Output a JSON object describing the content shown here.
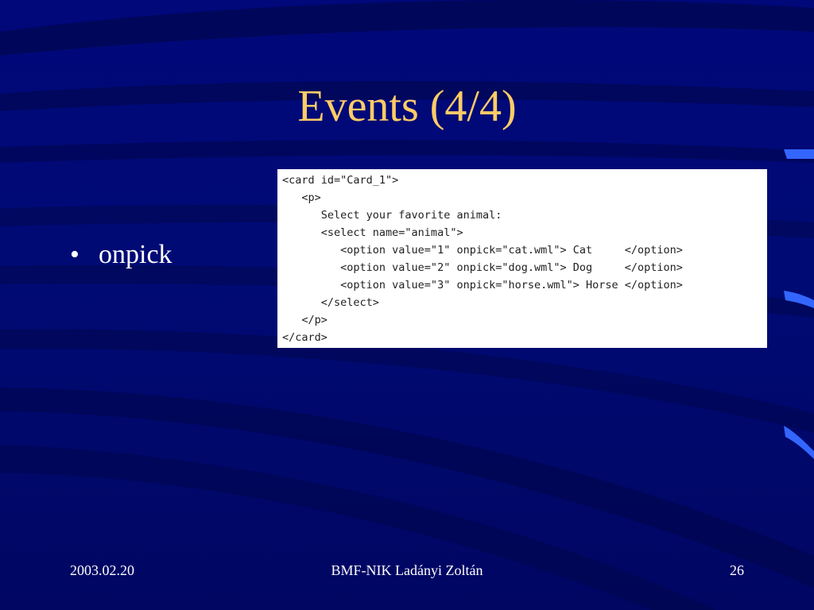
{
  "slide": {
    "title": "Events (4/4)",
    "bullets": [
      {
        "symbol": "•",
        "text": "onpick"
      }
    ],
    "code_lines": [
      "<card id=\"Card_1\">",
      "   <p>",
      "      Select your favorite animal:",
      "      <select name=\"animal\">",
      "         <option value=\"1\" onpick=\"cat.wml\"> Cat     </option>",
      "         <option value=\"2\" onpick=\"dog.wml\"> Dog     </option>",
      "         <option value=\"3\" onpick=\"horse.wml\"> Horse </option>",
      "      </select>",
      "   </p>",
      "</card>"
    ]
  },
  "footer": {
    "date": "2003.02.20",
    "author": "BMF-NIK Ladányi Zoltán",
    "page_number": "26"
  },
  "colors": {
    "background": "#000a74",
    "title": "#ffcc66",
    "text": "#ffffff",
    "code_background": "#ffffff",
    "code_text": "#222222",
    "accent_stripe": "#3366ff"
  }
}
